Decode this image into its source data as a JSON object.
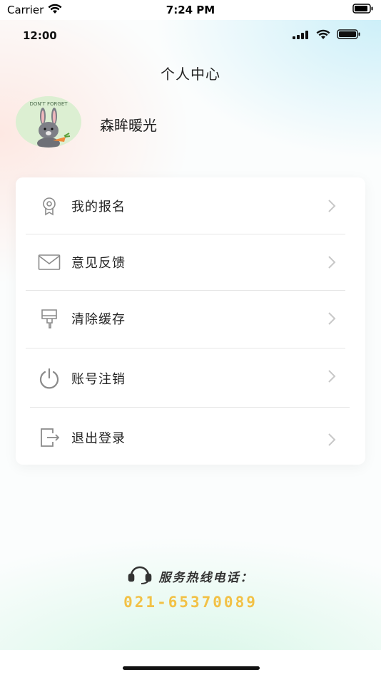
{
  "simulator_status": {
    "carrier": "Carrier",
    "time": "7:24 PM"
  },
  "app_status": {
    "time": "12:00"
  },
  "header": {
    "title": "个人中心"
  },
  "profile": {
    "avatar_text": "DON'T FORGET",
    "name": "森眸暖光"
  },
  "menu": {
    "items": [
      {
        "label": "我的报名",
        "icon": "award-icon"
      },
      {
        "label": "意见反馈",
        "icon": "mail-icon"
      },
      {
        "label": "清除缓存",
        "icon": "brush-icon"
      },
      {
        "label": "账号注销",
        "icon": "power-icon"
      },
      {
        "label": "退出登录",
        "icon": "logout-icon"
      }
    ]
  },
  "footer": {
    "hotline_label": "服务热线电话：",
    "hotline_number": "021-65370089"
  },
  "colors": {
    "accent_number": "#f2c146",
    "icon_gray": "#8a8a8a",
    "chevron_gray": "#c8c8c8"
  }
}
